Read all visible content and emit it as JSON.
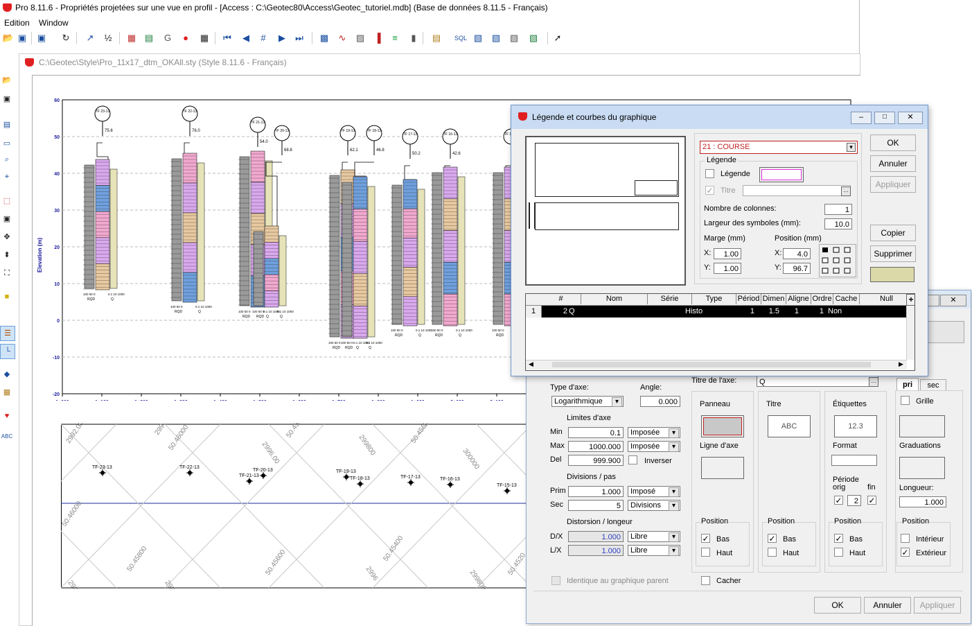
{
  "app": {
    "title": "Pro 8.11.6 - Propriétés projetées sur une vue en profil - [Access : C:\\Geotec80\\Access\\Geotec_tutoriel.mdb] (Base de données 8.11.5 - Français)",
    "menu": [
      "Edition",
      "Window"
    ],
    "accent": "#e02020"
  },
  "toolbar_icons": [
    "open-icon",
    "save-icon",
    "save-all-icon",
    "refresh-icon",
    "chart-icon",
    "fraction-icon",
    "copy-icon",
    "table-icon",
    "g-icon",
    "map-icon",
    "grid-icon",
    "first-icon",
    "prev-icon",
    "goto-icon",
    "next-icon",
    "last-icon",
    "hatch-icon",
    "line-icon",
    "pattern-icon",
    "bar-icon",
    "legend-icon",
    "cylinder-icon",
    "report-icon",
    "sql-icon",
    "db-icon",
    "db-link-icon",
    "db-check-icon",
    "db-export-icon",
    "pointer-icon"
  ],
  "toolbar_labels": [
    "",
    "",
    "",
    "",
    "",
    "",
    "",
    "",
    "G",
    "",
    "",
    "|◀",
    "◀",
    "#",
    "▶",
    "▶|",
    "",
    "",
    "",
    "",
    "",
    "",
    "",
    "SQL",
    "",
    "",
    "",
    "",
    ""
  ],
  "style_window": {
    "title": "C:\\Geotec\\Style\\Pro_11x17_dtm_OKAll.sty (Style 8.11.6 - Français)"
  },
  "profile": {
    "ylabel": "Elevation (m)",
    "xlabel": "Distance (m)",
    "yticks": [
      "60",
      "50",
      "40",
      "30",
      "20",
      "10",
      "0",
      "-10",
      "-20"
    ],
    "xticks": [
      "1+000",
      "1+100",
      "1+200",
      "1+300",
      "1+400",
      "1+500",
      "1+600",
      "1+700",
      "1+800",
      "1+900",
      "2+000",
      "2+100"
    ],
    "boreholes": [
      {
        "label": "TF 23-13",
        "value": "75.6"
      },
      {
        "label": "TF 22-13",
        "value": "76.0"
      },
      {
        "label": "TF 21-13",
        "value": "54.0"
      },
      {
        "label": "TF 20-13",
        "value": "68.8"
      },
      {
        "label": "TF 19-13",
        "value": "62.1"
      },
      {
        "label": "TF 18-13",
        "value": "46.8"
      },
      {
        "label": "TF 17-13",
        "value": "50.2"
      },
      {
        "label": "TF 16-13",
        "value": "42.6"
      },
      {
        "label": "TF 15-13",
        "value": ""
      }
    ],
    "footer_labels": [
      "100 50 0",
      "0.1 10 1000",
      "RQD",
      "Q"
    ]
  },
  "plan": {
    "grid_labels": [
      "2992.00",
      "299",
      "50.46000",
      "2996.00",
      "50.45800",
      "299800",
      "50.45600",
      "300000",
      "50.46000",
      "50.45800",
      "2992.00",
      "50.45600",
      "2996",
      "50.45400",
      "299800",
      "50.4520",
      "2990.00"
    ],
    "stations": [
      "TF-23-13",
      "TF-22-13",
      "TF-21-13",
      "TF-20-13",
      "TF-19-13",
      "TF-18-13",
      "TF-17-13",
      "TF-16-13",
      "TF-15-13"
    ]
  },
  "legend_dialog": {
    "title": "Légende et courbes du graphique",
    "series_select": "21 : COURSE",
    "legend_group": "Légende",
    "legend_chk": "Légende",
    "titre_chk": "Titre",
    "columns_label": "Nombre de colonnes:",
    "columns_value": "1",
    "symbol_width_label": "Largeur des symboles (mm):",
    "symbol_width_value": "10.0",
    "margin_label": "Marge (mm)",
    "position_label": "Position (mm)",
    "margin_x": "1.00",
    "margin_y": "1.00",
    "pos_x": "4.0",
    "pos_y": "96.7",
    "x_label": "X:",
    "y_label": "Y:",
    "buttons": {
      "ok": "OK",
      "cancel": "Annuler",
      "apply": "Appliquer",
      "copy": "Copier",
      "delete": "Supprimer"
    },
    "table": {
      "headers": [
        "#",
        "Nom",
        "Série",
        "Type",
        "Périod",
        "Dimen",
        "Aligne",
        "Ordre",
        "Cache",
        "Null"
      ],
      "rows": [
        [
          "1",
          "2",
          "Q",
          "",
          "Histo",
          "1",
          "1.5",
          "1",
          "1",
          "Non",
          ""
        ]
      ]
    }
  },
  "axis_dialog": {
    "axis_type_label": "Type d'axe:",
    "axis_type_value": "Logarithmique",
    "angle_label": "Angle:",
    "angle_value": "0.000",
    "limits_label": "Limites d'axe",
    "min_label": "Min",
    "min_value": "0.1",
    "min_mode": "Imposée",
    "max_label": "Max",
    "max_value": "1000.000",
    "max_mode": "Imposée",
    "del_label": "Del",
    "del_value": "999.900",
    "invert_label": "Inverser",
    "divisions_label": "Divisions / pas",
    "prim_label": "Prim",
    "prim_value": "1.000",
    "prim_mode": "Imposé",
    "sec_label": "Sec",
    "sec_value": "5",
    "sec_mode": "Divisions",
    "distortion_label": "Distorsion / longeur",
    "dx_label": "D/X",
    "dx_value": "1.000",
    "dx_mode": "Libre",
    "lx_label": "L/X",
    "lx_value": "1.000",
    "lx_mode": "Libre",
    "identical_label": "Identique au graphique parent",
    "axis_title_label": "Titre de l'axe:",
    "axis_title_value": "Q",
    "panneau_label": "Panneau",
    "ligne_axe_label": "Ligne d'axe",
    "titre_label": "Titre",
    "titre_sample": "ABC",
    "etiquettes_label": "Étiquettes",
    "etiquettes_sample": "12.3",
    "format_label": "Format",
    "periode_label": "Période",
    "orig_label": "orig",
    "fin_label": "fin",
    "periode_value": "2",
    "tabs": [
      "pri",
      "sec"
    ],
    "grille_label": "Grille",
    "graduations_label": "Graduations",
    "longueur_label": "Longueur:",
    "longueur_value": "1.000",
    "position_label": "Position",
    "bas_label": "Bas",
    "haut_label": "Haut",
    "interieur_label": "Intérieur",
    "exterieur_label": "Extérieur",
    "cacher_label": "Cacher",
    "buttons": {
      "ok": "OK",
      "cancel": "Annuler",
      "apply": "Appliquer"
    }
  }
}
